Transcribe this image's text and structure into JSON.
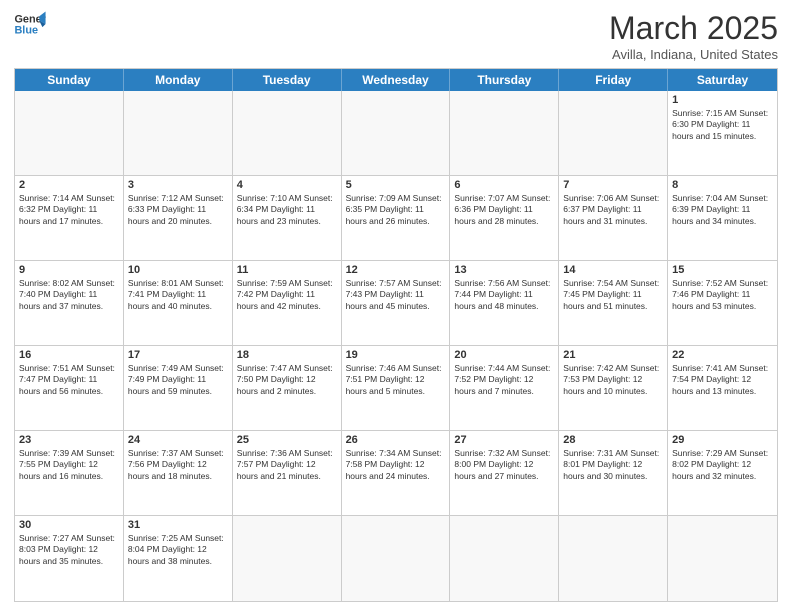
{
  "header": {
    "logo_general": "General",
    "logo_blue": "Blue",
    "month_title": "March 2025",
    "subtitle": "Avilla, Indiana, United States"
  },
  "weekdays": [
    "Sunday",
    "Monday",
    "Tuesday",
    "Wednesday",
    "Thursday",
    "Friday",
    "Saturday"
  ],
  "rows": [
    [
      {
        "day": "",
        "info": ""
      },
      {
        "day": "",
        "info": ""
      },
      {
        "day": "",
        "info": ""
      },
      {
        "day": "",
        "info": ""
      },
      {
        "day": "",
        "info": ""
      },
      {
        "day": "",
        "info": ""
      },
      {
        "day": "1",
        "info": "Sunrise: 7:15 AM\nSunset: 6:30 PM\nDaylight: 11 hours\nand 15 minutes."
      }
    ],
    [
      {
        "day": "2",
        "info": "Sunrise: 7:14 AM\nSunset: 6:32 PM\nDaylight: 11 hours\nand 17 minutes."
      },
      {
        "day": "3",
        "info": "Sunrise: 7:12 AM\nSunset: 6:33 PM\nDaylight: 11 hours\nand 20 minutes."
      },
      {
        "day": "4",
        "info": "Sunrise: 7:10 AM\nSunset: 6:34 PM\nDaylight: 11 hours\nand 23 minutes."
      },
      {
        "day": "5",
        "info": "Sunrise: 7:09 AM\nSunset: 6:35 PM\nDaylight: 11 hours\nand 26 minutes."
      },
      {
        "day": "6",
        "info": "Sunrise: 7:07 AM\nSunset: 6:36 PM\nDaylight: 11 hours\nand 28 minutes."
      },
      {
        "day": "7",
        "info": "Sunrise: 7:06 AM\nSunset: 6:37 PM\nDaylight: 11 hours\nand 31 minutes."
      },
      {
        "day": "8",
        "info": "Sunrise: 7:04 AM\nSunset: 6:39 PM\nDaylight: 11 hours\nand 34 minutes."
      }
    ],
    [
      {
        "day": "9",
        "info": "Sunrise: 8:02 AM\nSunset: 7:40 PM\nDaylight: 11 hours\nand 37 minutes."
      },
      {
        "day": "10",
        "info": "Sunrise: 8:01 AM\nSunset: 7:41 PM\nDaylight: 11 hours\nand 40 minutes."
      },
      {
        "day": "11",
        "info": "Sunrise: 7:59 AM\nSunset: 7:42 PM\nDaylight: 11 hours\nand 42 minutes."
      },
      {
        "day": "12",
        "info": "Sunrise: 7:57 AM\nSunset: 7:43 PM\nDaylight: 11 hours\nand 45 minutes."
      },
      {
        "day": "13",
        "info": "Sunrise: 7:56 AM\nSunset: 7:44 PM\nDaylight: 11 hours\nand 48 minutes."
      },
      {
        "day": "14",
        "info": "Sunrise: 7:54 AM\nSunset: 7:45 PM\nDaylight: 11 hours\nand 51 minutes."
      },
      {
        "day": "15",
        "info": "Sunrise: 7:52 AM\nSunset: 7:46 PM\nDaylight: 11 hours\nand 53 minutes."
      }
    ],
    [
      {
        "day": "16",
        "info": "Sunrise: 7:51 AM\nSunset: 7:47 PM\nDaylight: 11 hours\nand 56 minutes."
      },
      {
        "day": "17",
        "info": "Sunrise: 7:49 AM\nSunset: 7:49 PM\nDaylight: 11 hours\nand 59 minutes."
      },
      {
        "day": "18",
        "info": "Sunrise: 7:47 AM\nSunset: 7:50 PM\nDaylight: 12 hours\nand 2 minutes."
      },
      {
        "day": "19",
        "info": "Sunrise: 7:46 AM\nSunset: 7:51 PM\nDaylight: 12 hours\nand 5 minutes."
      },
      {
        "day": "20",
        "info": "Sunrise: 7:44 AM\nSunset: 7:52 PM\nDaylight: 12 hours\nand 7 minutes."
      },
      {
        "day": "21",
        "info": "Sunrise: 7:42 AM\nSunset: 7:53 PM\nDaylight: 12 hours\nand 10 minutes."
      },
      {
        "day": "22",
        "info": "Sunrise: 7:41 AM\nSunset: 7:54 PM\nDaylight: 12 hours\nand 13 minutes."
      }
    ],
    [
      {
        "day": "23",
        "info": "Sunrise: 7:39 AM\nSunset: 7:55 PM\nDaylight: 12 hours\nand 16 minutes."
      },
      {
        "day": "24",
        "info": "Sunrise: 7:37 AM\nSunset: 7:56 PM\nDaylight: 12 hours\nand 18 minutes."
      },
      {
        "day": "25",
        "info": "Sunrise: 7:36 AM\nSunset: 7:57 PM\nDaylight: 12 hours\nand 21 minutes."
      },
      {
        "day": "26",
        "info": "Sunrise: 7:34 AM\nSunset: 7:58 PM\nDaylight: 12 hours\nand 24 minutes."
      },
      {
        "day": "27",
        "info": "Sunrise: 7:32 AM\nSunset: 8:00 PM\nDaylight: 12 hours\nand 27 minutes."
      },
      {
        "day": "28",
        "info": "Sunrise: 7:31 AM\nSunset: 8:01 PM\nDaylight: 12 hours\nand 30 minutes."
      },
      {
        "day": "29",
        "info": "Sunrise: 7:29 AM\nSunset: 8:02 PM\nDaylight: 12 hours\nand 32 minutes."
      }
    ],
    [
      {
        "day": "30",
        "info": "Sunrise: 7:27 AM\nSunset: 8:03 PM\nDaylight: 12 hours\nand 35 minutes."
      },
      {
        "day": "31",
        "info": "Sunrise: 7:25 AM\nSunset: 8:04 PM\nDaylight: 12 hours\nand 38 minutes."
      },
      {
        "day": "",
        "info": ""
      },
      {
        "day": "",
        "info": ""
      },
      {
        "day": "",
        "info": ""
      },
      {
        "day": "",
        "info": ""
      },
      {
        "day": "",
        "info": ""
      }
    ]
  ]
}
